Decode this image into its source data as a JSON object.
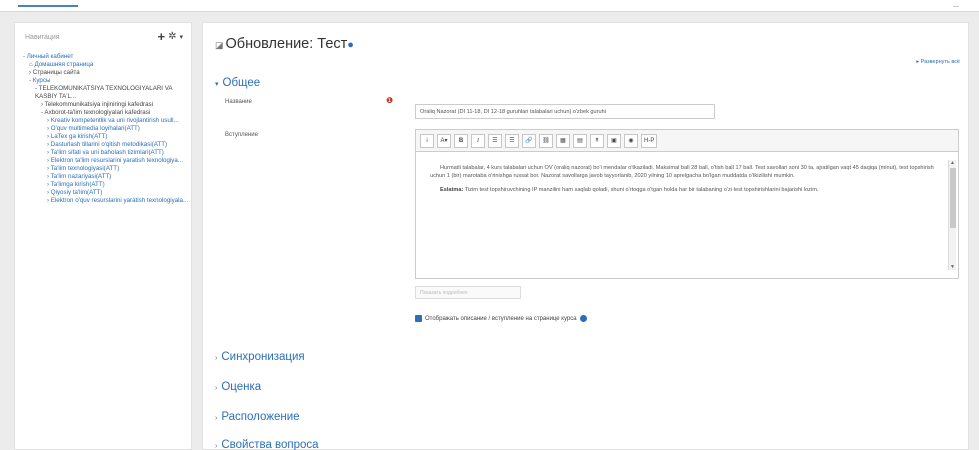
{
  "sidebar": {
    "title": "Навигация",
    "items": [
      {
        "label": "- Личный кабинет",
        "indent": 0,
        "kind": "link"
      },
      {
        "label": "Домашняя страница",
        "indent": 1,
        "kind": "home"
      },
      {
        "label": "› Страницы сайта",
        "indent": 1,
        "kind": "plain"
      },
      {
        "label": "- Курсы",
        "indent": 1,
        "kind": "link"
      },
      {
        "label": "- TELEKOMUNIKATSIYA TEXNOLOGIYALARI VA KASBIY TA'L...",
        "indent": 2,
        "kind": "plain"
      },
      {
        "label": "› Telekommunikatsiya injiniringi kafedrasi",
        "indent": 3,
        "kind": "plain"
      },
      {
        "label": "- Axborot-ta'lim texnologiyalari kafedrasi",
        "indent": 3,
        "kind": "plain"
      },
      {
        "label": "› Kreativ kompetentlik va uni rivojlantirish usull...",
        "indent": 4,
        "kind": "link"
      },
      {
        "label": "› O'quv multimedia loyihalari(ATT)",
        "indent": 4,
        "kind": "link"
      },
      {
        "label": "› LaTex ga kirish(ATT)",
        "indent": 4,
        "kind": "link"
      },
      {
        "label": "› Dasturlash tillarini o'qitish metodikasi(ATT)",
        "indent": 4,
        "kind": "link"
      },
      {
        "label": "› Ta'lim sifati va uni baholash tizimlari(ATT)",
        "indent": 4,
        "kind": "link"
      },
      {
        "label": "› Elektron ta'lim resurslarini yaratish texnologiya...",
        "indent": 4,
        "kind": "link"
      },
      {
        "label": "› Ta'lim texnologiyasi(ATT)",
        "indent": 4,
        "kind": "link"
      },
      {
        "label": "› Ta'lim nazariyasi(ATT)",
        "indent": 4,
        "kind": "link"
      },
      {
        "label": "› Ta'limga kirish(ATT)",
        "indent": 4,
        "kind": "link"
      },
      {
        "label": "› Qiyosiy ta'lim(ATT)",
        "indent": 4,
        "kind": "link"
      },
      {
        "label": "› Elektron o'quv resurslarini yaratish texnologiyala...",
        "indent": 4,
        "kind": "link"
      }
    ]
  },
  "main": {
    "title": "Обновление: Тест",
    "expand_all": "Развернуть всё",
    "section_general": "Общее",
    "name_label": "Название",
    "name_value": "Oraliq Nazorat (DI 11-18, DI 12-18 guruhlari talabalari uchun) o'zbek guruhi",
    "intro_label": "Вступление",
    "editor_text_1": "Hurmatli talabalar, 4 kurs talabalari uchun OV (oraliq nazorat) bo'i mendalar o'tkaziladi. Maksimal ball 28 ball, o'tish ball 17 ball. Test savollari soni 30 ta, ajratilgan vaqt 45 daqiqa (minut), test topshirish uchun 1 (bir) marotaba o'rinishga ruxsat bor. Nazorat savollarga javob tayyorlanib, 2020 yilning 10 aprelgacha bo'lgan muddatda o'tkizilishi mumkin.",
    "editor_bold_word": "Eslatma:",
    "editor_text_2": "Tizim test topshiruvchining IP manzilini ham saqlab qoladi, shuni o'rtoqga o'tgan holda har bir talabaning o'zi test topshirishlarini bajarishi lozim.",
    "ghost_button": "Показать подробнее",
    "show_description": "Отображать описание / вступление на странице курса",
    "sections": [
      "Синхронизация",
      "Оценка",
      "Расположение",
      "Свойства вопроса"
    ]
  },
  "toolbar": {
    "buttons": [
      "i",
      "A▾",
      "B",
      "I",
      "☰",
      "☰",
      "🔗",
      "⛓",
      "▦",
      "▤",
      "↟",
      "▣",
      "◉",
      "H-P"
    ]
  },
  "colors": {
    "accent": "#2a6fb8",
    "required": "#c0392b"
  }
}
